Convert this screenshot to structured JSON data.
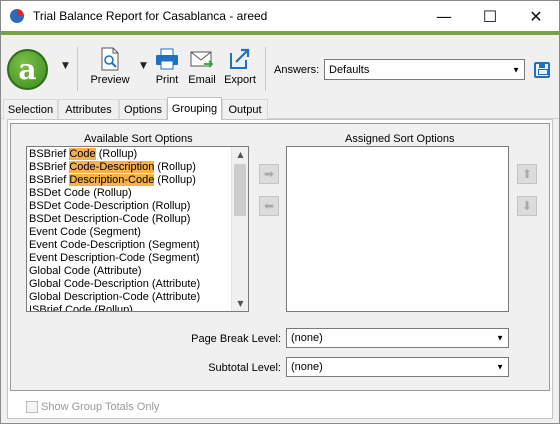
{
  "window": {
    "title": "Trial Balance Report for Casablanca - areed",
    "minimize_glyph": "—",
    "maximize_glyph": "☐",
    "close_glyph": "✕"
  },
  "toolbar": {
    "logo_letter": "a",
    "preview_label": "Preview",
    "print_label": "Print",
    "email_label": "Email",
    "export_label": "Export",
    "answers_label": "Answers:",
    "answers_value": "Defaults"
  },
  "tabs": [
    {
      "label": "Selection"
    },
    {
      "label": "Attributes"
    },
    {
      "label": "Options"
    },
    {
      "label": "Grouping"
    },
    {
      "label": "Output"
    }
  ],
  "grouping": {
    "available_title": "Available Sort Options",
    "assigned_title": "Assigned Sort Options",
    "available_options": [
      {
        "prefix": "BSBrief ",
        "highlight": "Code",
        "suffix": " (Rollup)"
      },
      {
        "prefix": "BSBrief ",
        "highlight": "Code-Description",
        "suffix": " (Rollup)"
      },
      {
        "prefix": "BSBrief ",
        "highlight": "Description-Code",
        "suffix": " (Rollup)"
      },
      {
        "prefix": "BSDet Code (Rollup)",
        "highlight": "",
        "suffix": ""
      },
      {
        "prefix": "BSDet Code-Description (Rollup)",
        "highlight": "",
        "suffix": ""
      },
      {
        "prefix": "BSDet Description-Code (Rollup)",
        "highlight": "",
        "suffix": ""
      },
      {
        "prefix": "Event Code (Segment)",
        "highlight": "",
        "suffix": ""
      },
      {
        "prefix": "Event Code-Description (Segment)",
        "highlight": "",
        "suffix": ""
      },
      {
        "prefix": "Event Description-Code (Segment)",
        "highlight": "",
        "suffix": ""
      },
      {
        "prefix": "Global Code (Attribute)",
        "highlight": "",
        "suffix": ""
      },
      {
        "prefix": "Global Code-Description (Attribute)",
        "highlight": "",
        "suffix": ""
      },
      {
        "prefix": "Global Description-Code (Attribute)",
        "highlight": "",
        "suffix": ""
      },
      {
        "prefix": "ISBrief Code (Rollup)",
        "highlight": "",
        "suffix": ""
      }
    ],
    "page_break_label": "Page Break Level:",
    "page_break_value": "(none)",
    "subtotal_label": "Subtotal Level:",
    "subtotal_value": "(none)",
    "show_group_totals_label": "Show Group Totals Only"
  },
  "colors": {
    "accent_bar": "#7aa23d",
    "highlight": "#f5b24a",
    "logo_green": "#4a9e24"
  }
}
